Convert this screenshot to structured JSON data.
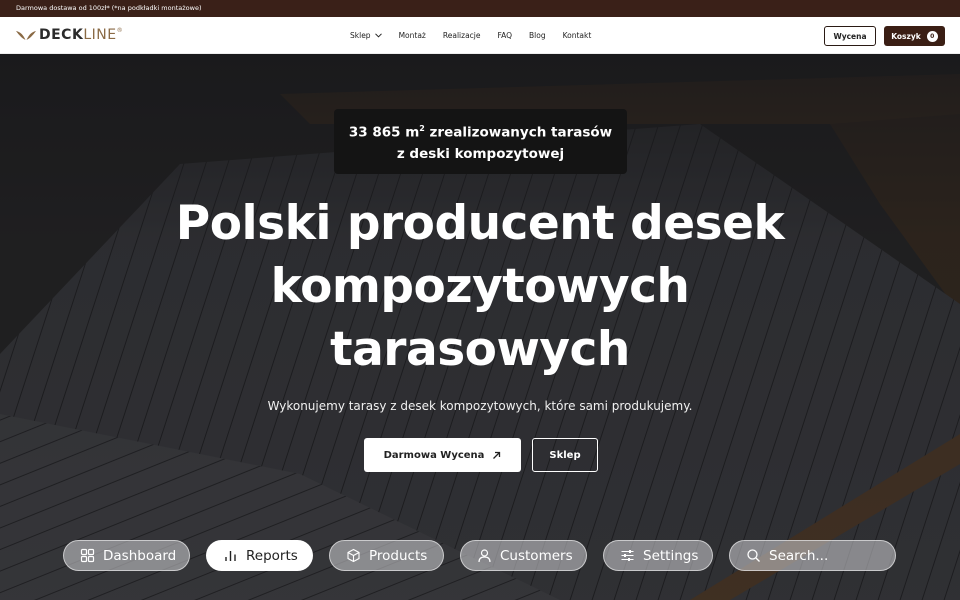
{
  "promo": {
    "text": "Darmowa dostawa od 100zł* (*na podkładki montażowe)"
  },
  "header": {
    "logo": {
      "part1": "DECK",
      "part2": "LINE",
      "mark": "®"
    },
    "nav": [
      {
        "label": "Sklep",
        "has_dropdown": true
      },
      {
        "label": "Montaż"
      },
      {
        "label": "Realizacje"
      },
      {
        "label": "FAQ"
      },
      {
        "label": "Blog"
      },
      {
        "label": "Kontakt"
      }
    ],
    "quote_button": "Wycena",
    "cart_button": "Koszyk",
    "cart_count": "0"
  },
  "hero": {
    "stat_line1_value": "33 865 m",
    "stat_line1_sup": "2",
    "stat_line1_rest": " zrealizowanych tarasów",
    "stat_line2": "z deski kompozytowej",
    "headline_line1": "Polski producent desek",
    "headline_line2": "kompozytowych",
    "headline_line3": "tarasowych",
    "subline": "Wykonujemy tarasy z desek kompozytowych, które sami produkujemy.",
    "cta_primary": "Darmowa Wycena",
    "cta_secondary": "Sklep"
  },
  "pill_nav": [
    {
      "label": "Dashboard",
      "icon": "dashboard-icon"
    },
    {
      "label": "Reports",
      "icon": "bar-chart-icon",
      "active": true
    },
    {
      "label": "Products",
      "icon": "box-icon"
    },
    {
      "label": "Customers",
      "icon": "user-icon"
    },
    {
      "label": "Settings",
      "icon": "sliders-icon"
    },
    {
      "label": "Search...",
      "icon": "search-icon"
    }
  ],
  "colors": {
    "promo_bg": "#3a2018",
    "cart_bg": "#3a1e14",
    "logo_accent": "#8a6a45"
  }
}
